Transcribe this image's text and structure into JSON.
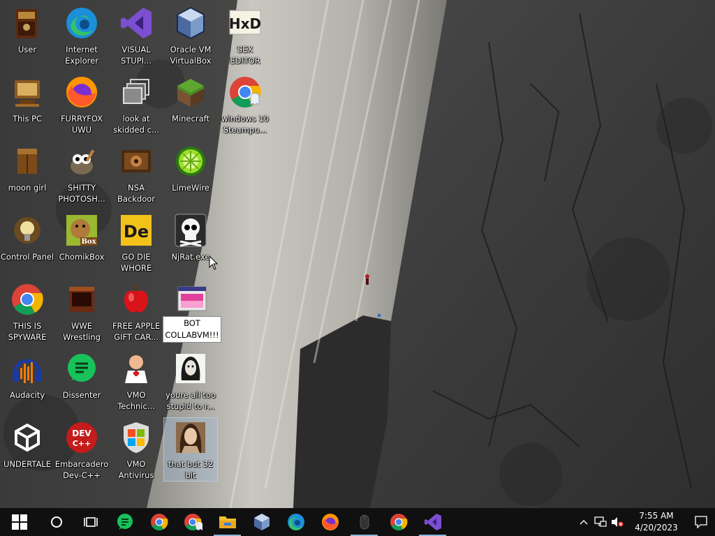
{
  "desktop": {
    "icons": [
      {
        "label": "User"
      },
      {
        "label": "Internet\nExplorer"
      },
      {
        "label": "VISUAL\nSTUPI..."
      },
      {
        "label": "Oracle VM\nVirtualBox"
      },
      {
        "label": "SEX\nEDITOR"
      },
      {
        "label": "This PC"
      },
      {
        "label": "FURRYFOX\nUWU"
      },
      {
        "label": "look at\nskidded c..."
      },
      {
        "label": "Minecraft"
      },
      {
        "label": "windows 10\nSteampu..."
      },
      {
        "label": "moon girl"
      },
      {
        "label": "SHITTY\nPHOTOSH..."
      },
      {
        "label": "NSA\nBackdoor"
      },
      {
        "label": "LimeWire"
      },
      {
        "label": "Control Panel"
      },
      {
        "label": "ChomikBox"
      },
      {
        "label": "GO DIE\nWHORE"
      },
      {
        "label": "NjRat.exe"
      },
      {
        "label": "THIS IS\nSPYWARE"
      },
      {
        "label": "WWE\nWrestling"
      },
      {
        "label": "FREE APPLE\nGIFT CAR..."
      },
      {
        "label": "BOT\nCOLLABVM!!!\n.exe"
      },
      {
        "label": "Audacity"
      },
      {
        "label": "Dissenter"
      },
      {
        "label": "VMO\nTechnic..."
      },
      {
        "label": "youre all too\nstupid to r..."
      },
      {
        "label": "UNDERTALE"
      },
      {
        "label": "Embarcadero\nDev-C++"
      },
      {
        "label": "VMO\nAntivirus"
      },
      {
        "label": "that but 32\nbit"
      }
    ],
    "glyph_text": {
      "hxd": "HxD",
      "box": "Box",
      "de": "De",
      "dev": "DEV\nC++"
    }
  },
  "taskbar": {
    "clock_time": "7:55 AM",
    "clock_date": "4/20/2023"
  },
  "colors": {
    "taskbar_bg": "#101010",
    "accent_underline": "#8ab4d8"
  }
}
